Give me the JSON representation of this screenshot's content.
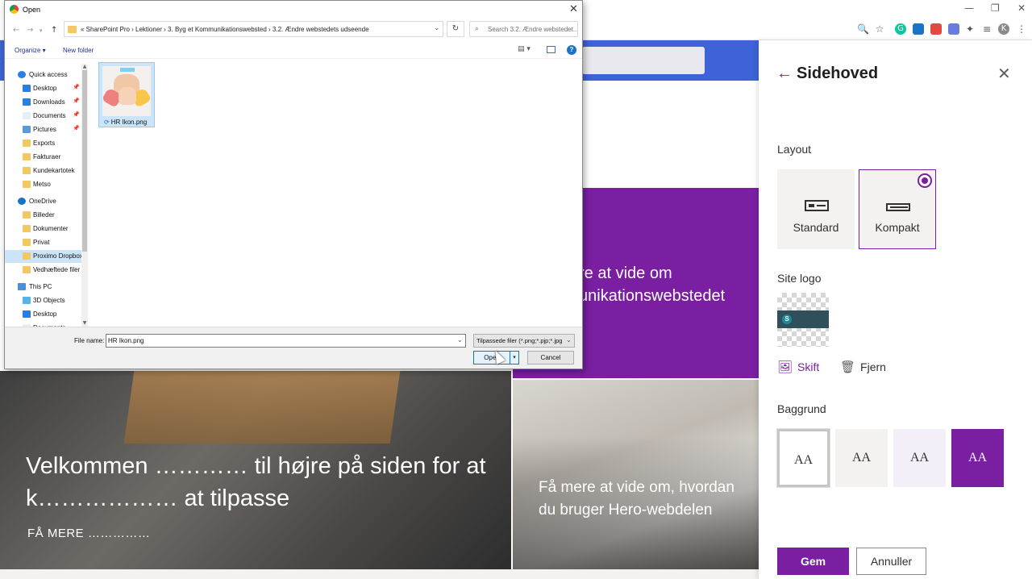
{
  "browser": {
    "window_controls": [
      "—",
      "❐",
      "✕"
    ],
    "avatar_letter": "K",
    "extensions": [
      "zoom-icon",
      "star-icon",
      "grammarly-icon",
      "screen-capture-icon",
      "extension-red-icon",
      "paint-icon",
      "puzzle-icon",
      "reading-list-icon",
      "profile-icon",
      "menu-icon"
    ]
  },
  "background_page": {
    "purple_tile_text": "re at vide om\nunikationswebstedet",
    "hero_title": "Velkommen ………… til højre på siden for at k……………… at tilpasse",
    "hero_more": "FÅ MERE ……………",
    "hero_small_title": "Få mere at vide om, hvordan du bruger Hero-webdelen"
  },
  "panel": {
    "title": "Sidehoved",
    "back_icon": "←",
    "close_icon": "✕",
    "layout_label": "Layout",
    "layouts": [
      {
        "label": "Standard",
        "selected": false
      },
      {
        "label": "Kompakt",
        "selected": true
      }
    ],
    "site_logo_label": "Site logo",
    "change_label": "Skift",
    "remove_label": "Fjern",
    "background_label": "Baggrund",
    "bg_swatches": [
      {
        "text": "AA",
        "bg": "#ffffff",
        "fg": "#323130",
        "selected": true
      },
      {
        "text": "AA",
        "bg": "#f3f2f1",
        "fg": "#323130",
        "selected": false
      },
      {
        "text": "AA",
        "bg": "#f4eef8",
        "fg": "#323130",
        "selected": false
      },
      {
        "text": "AA",
        "bg": "#7a1fa2",
        "fg": "#ffffff",
        "selected": false
      }
    ],
    "save_label": "Gem",
    "cancel_label": "Annuller",
    "accent": "#7a1fa2"
  },
  "dialog": {
    "title": "Open",
    "close": "✕",
    "breadcrumb": "«  SharePoint Pro  ›  Lektioner  ›  3. Byg et Kommunikationswebsted  ›  3.2. Ændre webstedets udseende",
    "search_placeholder": "Search 3.2. Ændre webstedet...",
    "organize": "Organize ▾",
    "new_folder": "New folder",
    "nav_items": [
      {
        "label": "Quick access",
        "icon": "star",
        "indent": 0,
        "pinned": false
      },
      {
        "label": "Desktop",
        "icon": "desktop",
        "indent": 1,
        "pinned": true
      },
      {
        "label": "Downloads",
        "icon": "download",
        "indent": 1,
        "pinned": true
      },
      {
        "label": "Documents",
        "icon": "doc",
        "indent": 1,
        "pinned": true
      },
      {
        "label": "Pictures",
        "icon": "pic",
        "indent": 1,
        "pinned": true
      },
      {
        "label": "Exports",
        "icon": "folder",
        "indent": 1,
        "pinned": false
      },
      {
        "label": "Fakturaer",
        "icon": "folder",
        "indent": 1,
        "pinned": false
      },
      {
        "label": "Kundekartotek",
        "icon": "folder",
        "indent": 1,
        "pinned": false
      },
      {
        "label": "Metso",
        "icon": "folder",
        "indent": 1,
        "pinned": false
      },
      {
        "label": "OneDrive",
        "icon": "cloud",
        "indent": 0,
        "pinned": false
      },
      {
        "label": "Billeder",
        "icon": "folder",
        "indent": 1,
        "pinned": false
      },
      {
        "label": "Dokumenter",
        "icon": "folder",
        "indent": 1,
        "pinned": false
      },
      {
        "label": "Privat",
        "icon": "folder",
        "indent": 1,
        "pinned": false
      },
      {
        "label": "Proximo Dropbox",
        "icon": "folder",
        "indent": 1,
        "pinned": false,
        "selected": true
      },
      {
        "label": "Vedhæftede filer",
        "icon": "folder",
        "indent": 1,
        "pinned": false
      },
      {
        "label": "This PC",
        "icon": "pc",
        "indent": 0,
        "pinned": false
      },
      {
        "label": "3D Objects",
        "icon": "3d",
        "indent": 1,
        "pinned": false
      },
      {
        "label": "Desktop",
        "icon": "desktop",
        "indent": 1,
        "pinned": false
      },
      {
        "label": "Documents",
        "icon": "doc",
        "indent": 1,
        "pinned": false
      }
    ],
    "file": {
      "name": "HR Ikon.png"
    },
    "file_name_label": "File name:",
    "file_name_value": "HR Ikon.png",
    "file_type": "Tilpassede filer (*.png;*.pjp;*.jpg",
    "open_label": "Open",
    "cancel_label": "Cancel"
  }
}
